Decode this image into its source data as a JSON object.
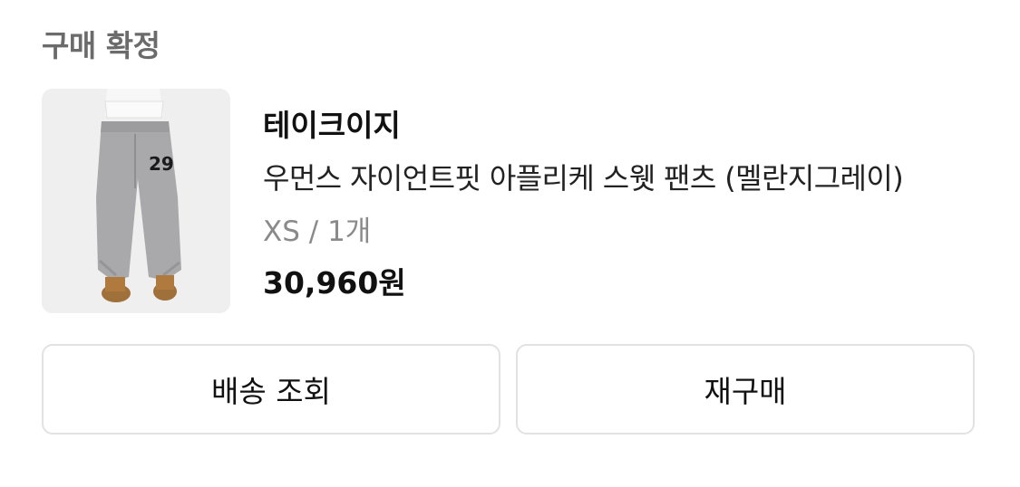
{
  "order": {
    "status": "구매 확정"
  },
  "product": {
    "brand": "테이크이지",
    "name": "우먼스 자이언트핏 아플리케 스웻 팬츠 (멜란지그레이)",
    "option": "XS / 1개",
    "price": "30,960원",
    "image_icon": "product-photo-sweatpants",
    "patch_text": "29"
  },
  "actions": {
    "track_label": "배송 조회",
    "reorder_label": "재구매"
  },
  "colors": {
    "status_text": "#6b6b6b",
    "option_text": "#8a8a8a",
    "button_border": "#e2e2e2"
  }
}
